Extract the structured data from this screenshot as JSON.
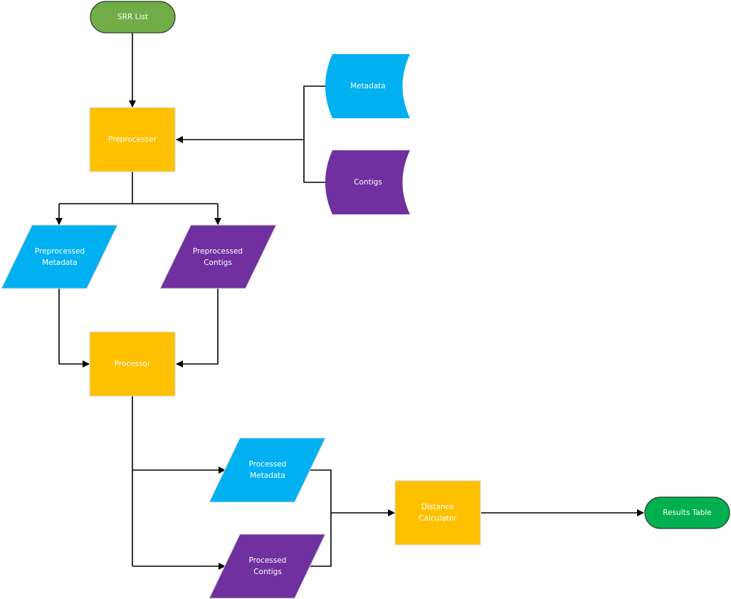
{
  "diagram": {
    "type": "flowchart",
    "colors": {
      "process": "#FFC000",
      "metadata": "#00B0F0",
      "contigs": "#7030A0",
      "start_terminal": "#70AD47",
      "end_terminal": "#00B050",
      "edge": "#000000",
      "label_text": "#FFFFFF"
    },
    "nodes": {
      "srr_list": {
        "label": "SRR List",
        "shape": "terminal"
      },
      "preprocesser": {
        "label": "Preprocesser",
        "shape": "process"
      },
      "metadata": {
        "label": "Metadata",
        "shape": "stored-data"
      },
      "contigs": {
        "label": "Contigs",
        "shape": "stored-data"
      },
      "preprocessed_metadata": {
        "line1": "Preprocessed",
        "line2": "Metadata",
        "shape": "data"
      },
      "preprocessed_contigs": {
        "line1": "Preprocessed",
        "line2": "Contigs",
        "shape": "data"
      },
      "processor": {
        "label": "Processor",
        "shape": "process"
      },
      "processed_metadata": {
        "line1": "Processed",
        "line2": "Metadata",
        "shape": "data"
      },
      "processed_contigs": {
        "line1": "Processed",
        "line2": "Contigs",
        "shape": "data"
      },
      "distance_calculator": {
        "line1": "Distance",
        "line2": "Calculator",
        "shape": "process"
      },
      "results_table": {
        "label": "Results Table",
        "shape": "terminal"
      }
    },
    "edges": [
      {
        "from": "SRR List",
        "to": "Preprocesser"
      },
      {
        "from": "Metadata",
        "to": "Preprocesser"
      },
      {
        "from": "Contigs",
        "to": "Preprocesser"
      },
      {
        "from": "Preprocesser",
        "to": "Preprocessed Metadata"
      },
      {
        "from": "Preprocesser",
        "to": "Preprocessed Contigs"
      },
      {
        "from": "Preprocessed Metadata",
        "to": "Processor"
      },
      {
        "from": "Preprocessed Contigs",
        "to": "Processor"
      },
      {
        "from": "Processor",
        "to": "Processed Metadata"
      },
      {
        "from": "Processor",
        "to": "Processed Contigs"
      },
      {
        "from": "Processed Metadata",
        "to": "Distance Calculator"
      },
      {
        "from": "Processed Contigs",
        "to": "Distance Calculator"
      },
      {
        "from": "Distance Calculator",
        "to": "Results Table"
      }
    ]
  }
}
